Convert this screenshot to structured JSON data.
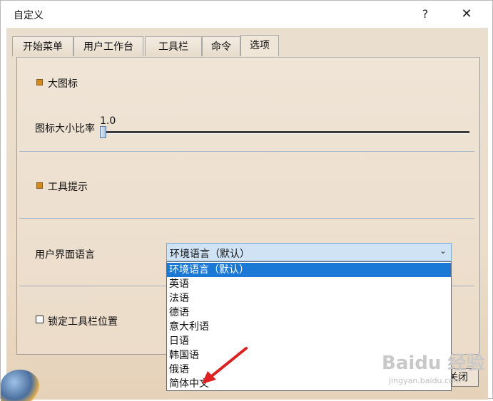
{
  "window": {
    "title": "自定义",
    "help_glyph": "?",
    "close_glyph": "✕"
  },
  "tabs": [
    {
      "label": "开始菜单"
    },
    {
      "label": "用户工作台"
    },
    {
      "label": "工具栏"
    },
    {
      "label": "命令"
    },
    {
      "label": "选项",
      "active": true
    }
  ],
  "options": {
    "large_icons": {
      "label": "大图标",
      "checked": true
    },
    "icon_ratio": {
      "label": "图标大小比率",
      "value": "1.0"
    },
    "tooltips": {
      "label": "工具提示",
      "checked": true
    },
    "ui_language": {
      "label": "用户界面语言",
      "selected": "环境语言（默认）",
      "items": [
        "环境语言（默认）",
        "英语",
        "法语",
        "德语",
        "意大利语",
        "日语",
        "韩国语",
        "俄语",
        "简体中文"
      ]
    },
    "lock_toolbar": {
      "label": "锁定工具栏位置",
      "checked": false
    }
  },
  "footer": {
    "close_label": "关闭"
  },
  "watermark": {
    "text": "Baidu 经验",
    "sub": "jingyan.baidu.com"
  },
  "colors": {
    "accent": "#1a78d7",
    "checked_icon": "#d48b1e",
    "panel_bg": "#ecdcc9",
    "arrow": "#e02020"
  }
}
